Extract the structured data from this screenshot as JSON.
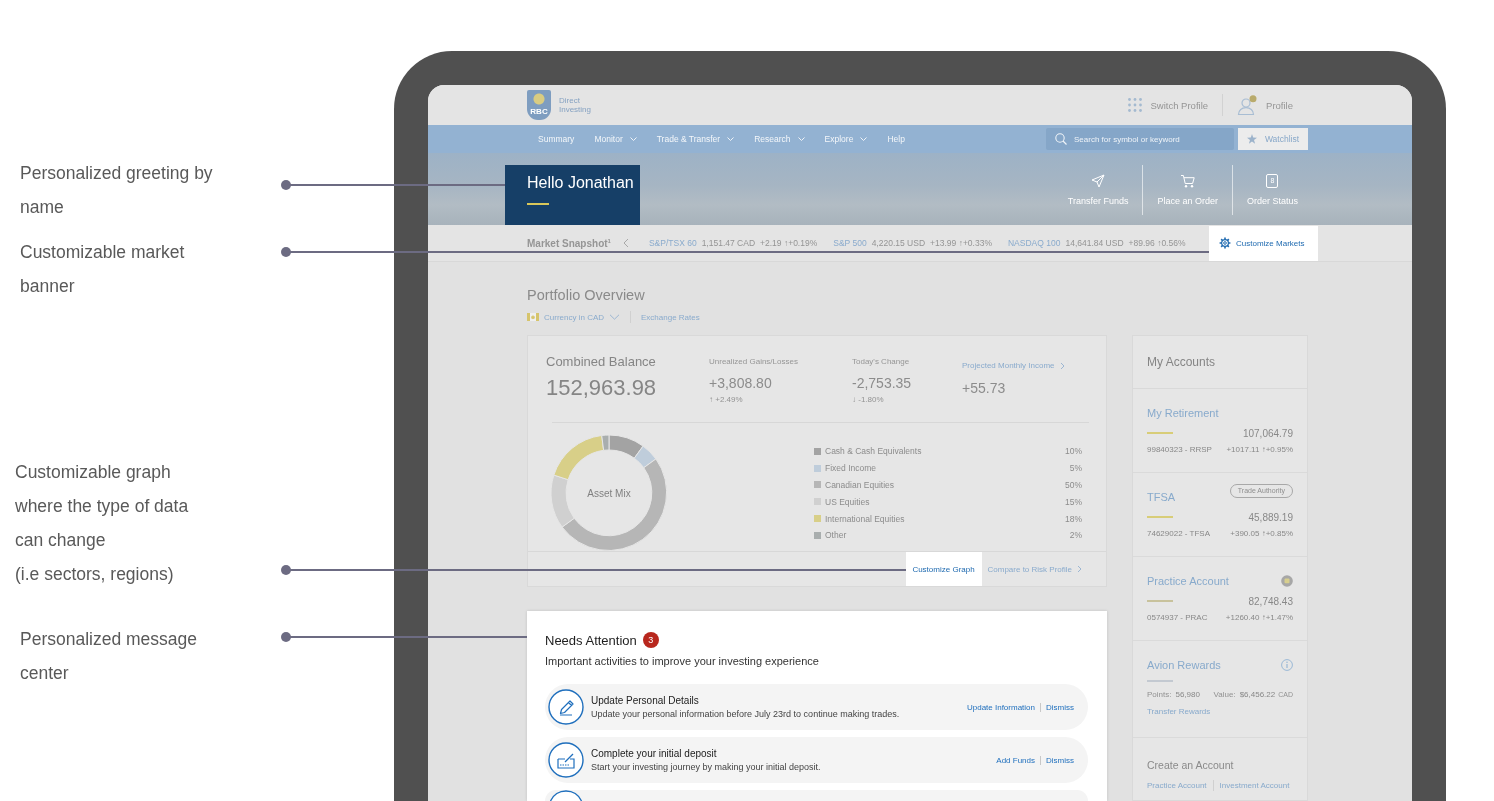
{
  "annotations": [
    {
      "text": "Personalized greeting by\nname"
    },
    {
      "text": "Customizable market\nbanner"
    },
    {
      "text": "Customizable graph\nwhere the type of data\ncan change\n(i.e sectors, regions)"
    },
    {
      "text": "Personalized message\ncenter"
    }
  ],
  "header": {
    "logo": {
      "mark": "RBC",
      "name": "Direct\nInvesting"
    },
    "switch_profile": "Switch Profile",
    "profile": "Profile"
  },
  "nav": {
    "items": [
      {
        "label": "Summary",
        "dropdown": false
      },
      {
        "label": "Monitor",
        "dropdown": true
      },
      {
        "label": "Trade & Transfer",
        "dropdown": true
      },
      {
        "label": "Research",
        "dropdown": true
      },
      {
        "label": "Explore",
        "dropdown": true
      },
      {
        "label": "Help",
        "dropdown": false
      }
    ],
    "search": {
      "placeholder": "Search for symbol or keyword"
    },
    "watchlist": "Watchlist"
  },
  "hero": {
    "greeting": "Hello Jonathan",
    "actions": [
      {
        "kind": "send",
        "label": "Transfer Funds"
      },
      {
        "kind": "cart",
        "label": "Place an Order"
      },
      {
        "kind": "count",
        "label": "Order Status",
        "count": "8"
      }
    ]
  },
  "market_snapshot": {
    "title": "Market Snapshot$^{1}$",
    "indices": [
      {
        "name": "S&P/TSX 60",
        "price": "1,151.47 CAD",
        "change": "+2.19 ↑+0.19%"
      },
      {
        "name": "S&P 500",
        "price": "4,220.15 USD",
        "change": "+13.99 ↑+0.33%"
      },
      {
        "name": "NASDAQ 100",
        "price": "14,641.84 USD",
        "change": "+89.96 ↑0.56%"
      }
    ],
    "customize": "Customize Markets"
  },
  "portfolio": {
    "title": "Portfolio Overview",
    "currency": "Currency in CAD",
    "exchange_rates": "Exchange Rates",
    "stats": [
      {
        "kind": "main",
        "label": "Combined Balance",
        "value": "152,963.98"
      },
      {
        "kind": "change",
        "label": "Unrealized Gains/Losses",
        "value": "+3,808.80",
        "delta": "↑ +2.49%"
      },
      {
        "kind": "change",
        "label": "Today's Change",
        "value": "-2,753.35",
        "delta": "↓ -1.80%"
      },
      {
        "kind": "link",
        "label": "Projected Monthly Income",
        "value": "+55.73"
      }
    ],
    "asset_mix": {
      "chart_data": {
        "type": "donut",
        "title": "Asset Mix",
        "categories": [
          "Cash & Cash Equivalents",
          "Fixed Income",
          "Canadian Equities",
          "US Equities",
          "International Equities",
          "Other"
        ],
        "values": [
          10,
          5,
          50,
          15,
          18,
          2
        ],
        "value_labels": [
          "10%",
          "5%",
          "50%",
          "15%",
          "18%",
          "2%"
        ],
        "colors": [
          "#a3a3a3",
          "#bfcddb",
          "#b6b6b6",
          "#d0d0d0",
          "#d8cf88",
          "#a9aeae"
        ]
      }
    },
    "customize_graph": "Customize Graph",
    "compare": "Compare to Risk Profile"
  },
  "needs_attention": {
    "title": "Needs Attention",
    "count": "3",
    "subtitle": "Important activities to improve your investing experience",
    "items": [
      {
        "kind": "pencil",
        "title": "Update Personal Details",
        "description": "Update your personal information before July 23rd to continue making trades.",
        "actions": [
          "Update Information",
          "Dismiss"
        ]
      },
      {
        "kind": "cheque",
        "title": "Complete your initial deposit",
        "description": "Start your investing journey by making your initial deposit.",
        "actions": [
          "Add Funds",
          "Dismiss"
        ]
      },
      {
        "kind": "cut_off"
      }
    ]
  },
  "accounts": {
    "title": "My Accounts",
    "items": [
      {
        "kind": "account",
        "name": "My Retirement",
        "color": "#d8cd78",
        "balance": "107,064.79",
        "number": "99840323 - RRSP",
        "change": "+1017.11 ↑+0.95%"
      },
      {
        "kind": "account",
        "name": "TFSA",
        "tag": "Trade Authority",
        "color": "#d8cd78",
        "balance": "45,889.19",
        "number": "74629022 - TFSA",
        "change": "+390.05 ↑+0.85%"
      },
      {
        "kind": "practice",
        "name": "Practice Account",
        "color": "#c8c29c",
        "balance": "82,748.43",
        "number": "0574937 - PRAC",
        "change": "+1260.40 ↑+1.47%"
      },
      {
        "kind": "rewards",
        "name": "Avion Rewards",
        "color": "#c3c9d1",
        "points_label": "Points:",
        "points": "56,980",
        "value_label": "Value:",
        "value": "$6,456.22",
        "currency": "CAD",
        "link": "Transfer Rewards"
      }
    ],
    "create": {
      "title": "Create an Account",
      "links": [
        "Practice Account",
        "Investment Account"
      ]
    }
  }
}
